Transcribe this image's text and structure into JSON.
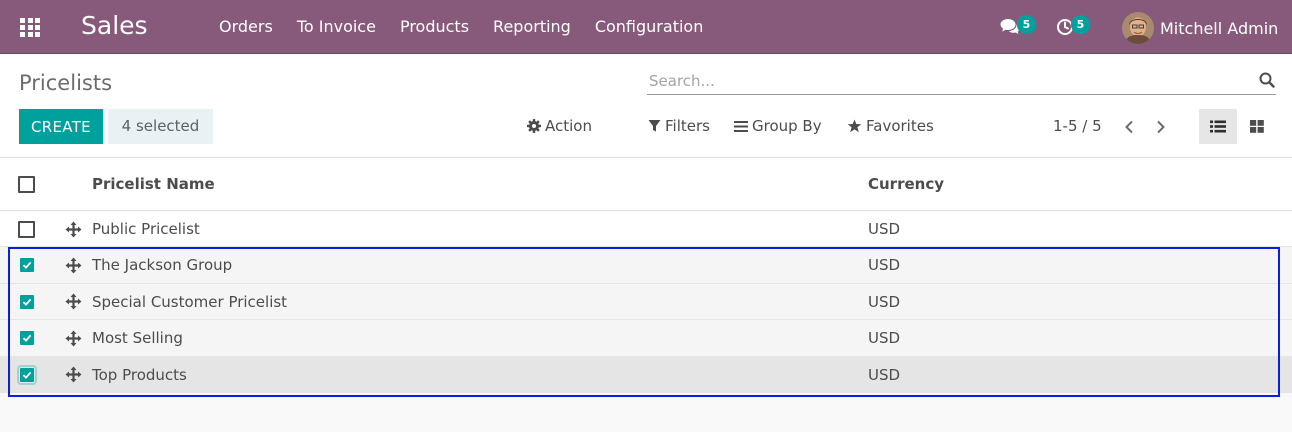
{
  "navbar": {
    "brand": "Sales",
    "menu": [
      "Orders",
      "To Invoice",
      "Products",
      "Reporting",
      "Configuration"
    ],
    "messages_count": "5",
    "activities_count": "5",
    "user_name": "Mitchell Admin"
  },
  "control_panel": {
    "title": "Pricelists",
    "search_placeholder": "Search...",
    "create_label": "CREATE",
    "selected_label": "4 selected",
    "action_label": "Action",
    "filters_label": "Filters",
    "group_by_label": "Group By",
    "favorites_label": "Favorites",
    "pager": "1-5 / 5"
  },
  "table": {
    "columns": [
      "Pricelist Name",
      "Currency"
    ],
    "rows": [
      {
        "name": "Public Pricelist",
        "currency": "USD",
        "checked": false
      },
      {
        "name": "The Jackson Group",
        "currency": "USD",
        "checked": true
      },
      {
        "name": "Special Customer Pricelist",
        "currency": "USD",
        "checked": true
      },
      {
        "name": "Most Selling",
        "currency": "USD",
        "checked": true
      },
      {
        "name": "Top Products",
        "currency": "USD",
        "checked": true
      }
    ]
  },
  "colors": {
    "navbar": "#875a7b",
    "primary": "#00a09d",
    "selection_frame": "#0a1fe6"
  }
}
